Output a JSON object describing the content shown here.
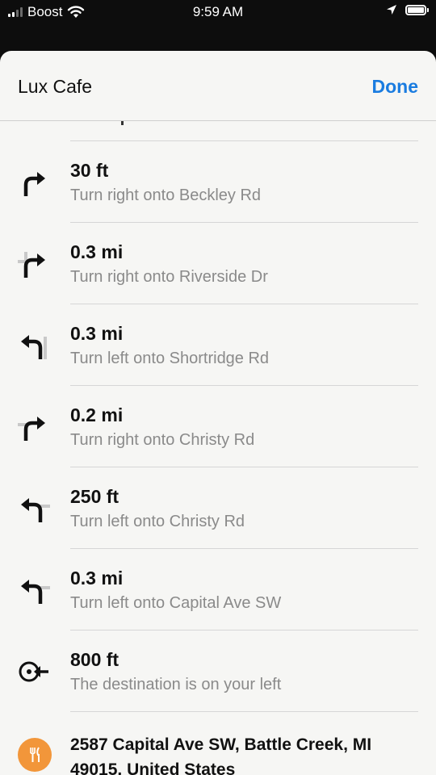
{
  "status_bar": {
    "carrier": "Boost",
    "time": "9:59 AM",
    "icons": [
      "signal-icon",
      "wifi-icon",
      "location-arrow-icon",
      "battery-icon"
    ]
  },
  "header": {
    "title": "Lux Cafe",
    "done_label": "Done"
  },
  "colors": {
    "accent": "#1a7ce0",
    "destination_badge": "#f2963a"
  },
  "steps": [
    {
      "distance": "30 ft",
      "instruction": "Turn right onto Beckley Rd",
      "icon": "turn-right-icon"
    },
    {
      "distance": "0.3 mi",
      "instruction": "Turn right onto Riverside Dr",
      "icon": "turn-right-icon"
    },
    {
      "distance": "0.3 mi",
      "instruction": "Turn left onto Shortridge Rd",
      "icon": "turn-left-icon"
    },
    {
      "distance": "0.2 mi",
      "instruction": "Turn right onto Christy Rd",
      "icon": "turn-right-icon"
    },
    {
      "distance": "250 ft",
      "instruction": "Turn left onto Christy Rd",
      "icon": "turn-left-icon"
    },
    {
      "distance": "0.3 mi",
      "instruction": "Turn left onto Capital Ave SW",
      "icon": "turn-left-icon"
    },
    {
      "distance": "800 ft",
      "instruction": "The destination is on your left",
      "icon": "arrive-left-icon"
    }
  ],
  "destination": {
    "address": "2587 Capital Ave SW, Battle Creek, MI 49015, United States",
    "icon": "restaurant-icon"
  }
}
